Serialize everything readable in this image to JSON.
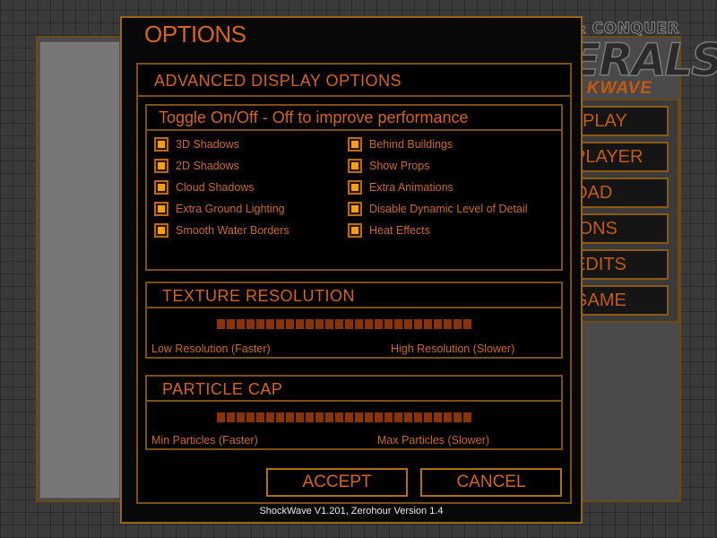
{
  "dialog": {
    "title": "OPTIONS",
    "panel_title": "ADVANCED DISPLAY OPTIONS",
    "footer": "ShockWave V1.201, Zerohour Version 1.4"
  },
  "logo": {
    "line1": "COMMAND & CONQUER",
    "line2": "GENERALS",
    "line3": "KWAVE"
  },
  "background_menu": {
    "items": [
      {
        "label": "PLAY"
      },
      {
        "label": "PLAYER"
      },
      {
        "label": "OAD"
      },
      {
        "label": "IONS"
      },
      {
        "label": "EDITS"
      },
      {
        "label": "GAME"
      }
    ]
  },
  "toggles": {
    "title": "Toggle On/Off - Off to improve performance",
    "left": [
      {
        "label": "3D Shadows",
        "checked": true
      },
      {
        "label": "2D Shadows",
        "checked": true
      },
      {
        "label": "Cloud Shadows",
        "checked": true
      },
      {
        "label": "Extra Ground Lighting",
        "checked": true
      },
      {
        "label": "Smooth Water Borders",
        "checked": true
      }
    ],
    "right": [
      {
        "label": "Behind Buildings",
        "checked": true
      },
      {
        "label": "Show Props",
        "checked": true
      },
      {
        "label": "Extra Animations",
        "checked": true
      },
      {
        "label": "Disable Dynamic Level of Detail",
        "checked": true
      },
      {
        "label": "Heat Effects",
        "checked": true
      }
    ]
  },
  "texture": {
    "title": "TEXTURE RESOLUTION",
    "low_label": "Low Resolution (Faster)",
    "high_label": "High Resolution (Slower)",
    "segments": 26
  },
  "particles": {
    "title": "PARTICLE CAP",
    "min_label": "Min Particles (Faster)",
    "max_label": "Max Particles (Slower)",
    "segments": 26
  },
  "buttons": {
    "accept": "ACCEPT",
    "cancel": "CANCEL"
  },
  "colors": {
    "accent": "#d8641a",
    "frame": "#7a5014",
    "checkbox_fill": "#f0a010",
    "slider_segment": "#8a3308"
  }
}
